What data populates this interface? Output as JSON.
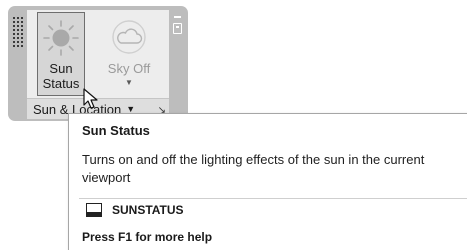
{
  "panel": {
    "title": "Sun & Location",
    "title_caret": "▼",
    "dialog_launcher": "↘"
  },
  "buttons": {
    "sun_status": {
      "label_line1": "Sun",
      "label_line2": "Status",
      "icon": "sun-icon"
    },
    "sky": {
      "label": "Sky Off",
      "icon": "cloud-icon",
      "caret": "▼"
    }
  },
  "tooltip": {
    "title": "Sun Status",
    "description": "Turns on and off the lighting effects of the sun in the current viewport",
    "command_icon": "command-line-icon",
    "command": "SUNSTATUS",
    "help": "Press F1 for more help"
  },
  "colors": {
    "panel_frame": "#bdbdbd",
    "panel_body": "#ededed",
    "sun_icon": "#a9a9a9",
    "sky_icon": "#c4c4c4"
  }
}
